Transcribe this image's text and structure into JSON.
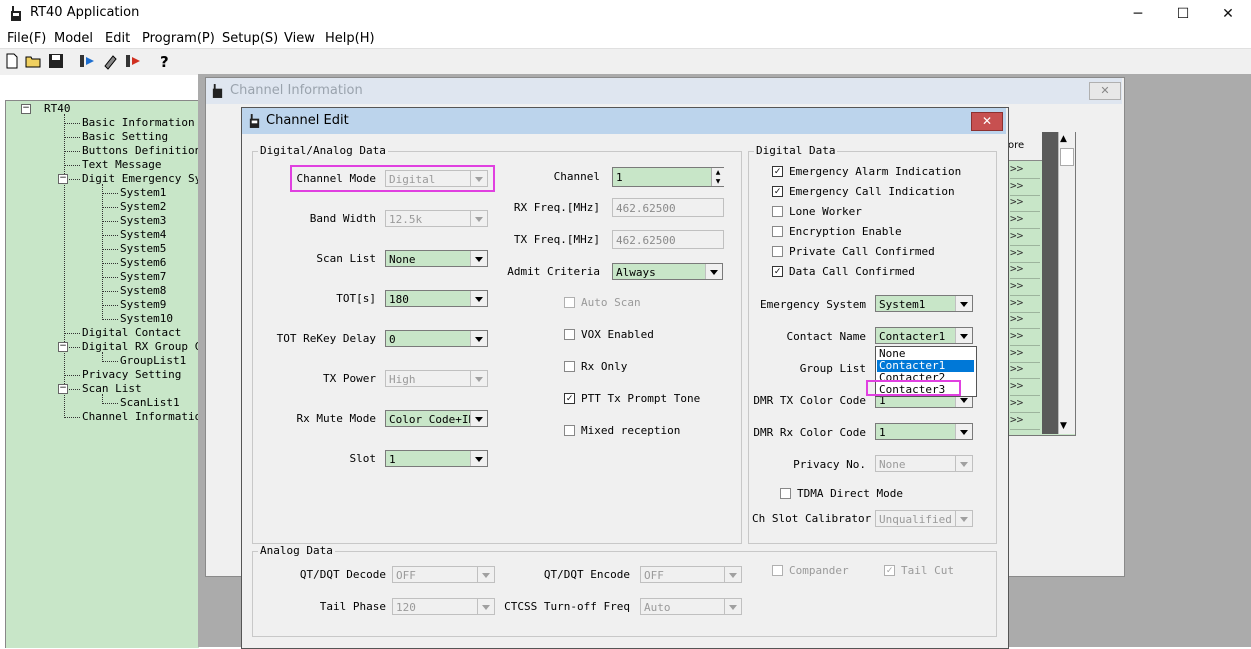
{
  "window": {
    "title": "RT40 Application",
    "controls": {
      "minimize": "─",
      "maximize": "☐",
      "close": "✕"
    }
  },
  "menu": [
    "File(F)",
    "Model",
    "Edit",
    "Program(P)",
    "Setup(S)",
    "View",
    "Help(H)"
  ],
  "tree": {
    "root": "RT40",
    "items": [
      "Basic Information",
      "Basic Setting",
      "Buttons Definitions",
      "Text Message",
      "Digit Emergency Sys",
      "System1",
      "System2",
      "System3",
      "System4",
      "System5",
      "System6",
      "System7",
      "System8",
      "System9",
      "System10",
      "Digital Contact",
      "Digital RX Group Ca",
      "GroupList1",
      "Privacy Setting",
      "Scan List",
      "ScanList1",
      "Channel Information"
    ]
  },
  "channel_info": {
    "title": "Channel Information",
    "close": "✕",
    "grid_header": "ore",
    "grid_cell": ">>"
  },
  "dialog": {
    "title": "Channel Edit",
    "close": "✕",
    "digital_analog": {
      "group_label": "Digital/Analog Data",
      "channel_mode": {
        "label": "Channel Mode",
        "value": "Digital"
      },
      "band_width": {
        "label": "Band Width",
        "value": "12.5k"
      },
      "scan_list": {
        "label": "Scan List",
        "value": "None"
      },
      "tot": {
        "label": "TOT[s]",
        "value": "180"
      },
      "tot_rekey": {
        "label": "TOT ReKey Delay",
        "value": "0"
      },
      "tx_power": {
        "label": "TX Power",
        "value": "High"
      },
      "rx_mute": {
        "label": "Rx Mute Mode",
        "value": "Color Code+ID"
      },
      "slot": {
        "label": "Slot",
        "value": "1"
      },
      "channel": {
        "label": "Channel",
        "value": "1"
      },
      "rx_freq": {
        "label": "RX Freq.[MHz]",
        "value": "462.62500"
      },
      "tx_freq": {
        "label": "TX Freq.[MHz]",
        "value": "462.62500"
      },
      "admit": {
        "label": "Admit Criteria",
        "value": "Always"
      },
      "auto_scan": {
        "label": "Auto Scan"
      },
      "vox": {
        "label": "VOX Enabled"
      },
      "rx_only": {
        "label": "Rx Only"
      },
      "ptt_tone": {
        "label": "PTT Tx Prompt Tone"
      },
      "mixed": {
        "label": "Mixed reception"
      }
    },
    "digital": {
      "group_label": "Digital Data",
      "emergency_alarm": "Emergency Alarm Indication",
      "emergency_call": "Emergency Call Indication",
      "lone_worker": "Lone Worker",
      "encryption": "Encryption Enable",
      "private_call": "Private Call Confirmed",
      "data_call": "Data Call Confirmed",
      "emergency_system": {
        "label": "Emergency System",
        "value": "System1"
      },
      "contact_name": {
        "label": "Contact Name",
        "value": "Contacter1"
      },
      "contact_options": [
        "None",
        "Contacter1",
        "Contacter2",
        "Contacter3"
      ],
      "group_list": {
        "label": "Group List"
      },
      "dmr_tx_cc": {
        "label": "DMR TX Color Code",
        "value": "1"
      },
      "dmr_rx_cc": {
        "label": "DMR Rx Color Code",
        "value": "1"
      },
      "privacy_no": {
        "label": "Privacy No.",
        "value": "None"
      },
      "tdma": "TDMA Direct Mode",
      "ch_slot_cal": {
        "label": "Ch Slot Calibrator",
        "value": "Unqualified"
      }
    },
    "analog": {
      "group_label": "Analog Data",
      "qt_decode": {
        "label": "QT/DQT Decode",
        "value": "OFF"
      },
      "qt_encode": {
        "label": "QT/DQT Encode",
        "value": "OFF"
      },
      "tail_phase": {
        "label": "Tail Phase",
        "value": "120"
      },
      "ctcss": {
        "label": "CTCSS Turn-off Freq",
        "value": "Auto"
      },
      "compander": "Compander",
      "tail_cut": "Tail Cut"
    }
  },
  "check_mark": "✓",
  "spin": {
    "up": "▲",
    "down": "▼"
  },
  "scroll": {
    "up": "▲",
    "down": "▼"
  },
  "colors": {
    "field_green": "#c8e6c8",
    "highlight": "#e040e0",
    "selection": "#0078d7"
  }
}
